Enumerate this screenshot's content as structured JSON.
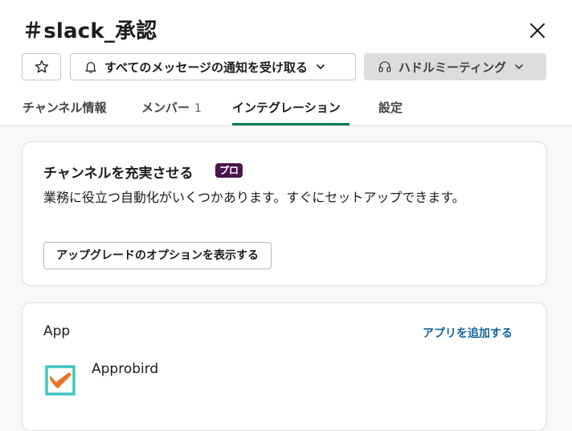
{
  "header": {
    "title": "＃slack_承認",
    "buttons": {
      "star_icon": "star-icon",
      "notify_label": "すべてのメッセージの通知を受け取る",
      "huddle_label": "ハドルミーティング"
    },
    "tabs": [
      {
        "label": "チャンネル情報"
      },
      {
        "label": "メンバー",
        "count": "1"
      },
      {
        "label": "インテグレーション"
      },
      {
        "label": "設定"
      }
    ],
    "active_tab": "インテグレーション"
  },
  "enhance_card": {
    "title": "チャンネルを充実させる",
    "badge": "プロ",
    "description": "業務に役立つ自動化がいくつかあります。すぐにセットアップできます。",
    "button_label": "アップグレードのオプションを表示する"
  },
  "apps_card": {
    "heading": "App",
    "add_link": "アプリを追加する",
    "apps": [
      {
        "name": "Approbird",
        "icon": "approbird-logo-icon"
      }
    ]
  },
  "colors": {
    "accent_tab_underline": "#007a5a",
    "link": "#1264a3",
    "pro_badge": "#4a154b"
  }
}
